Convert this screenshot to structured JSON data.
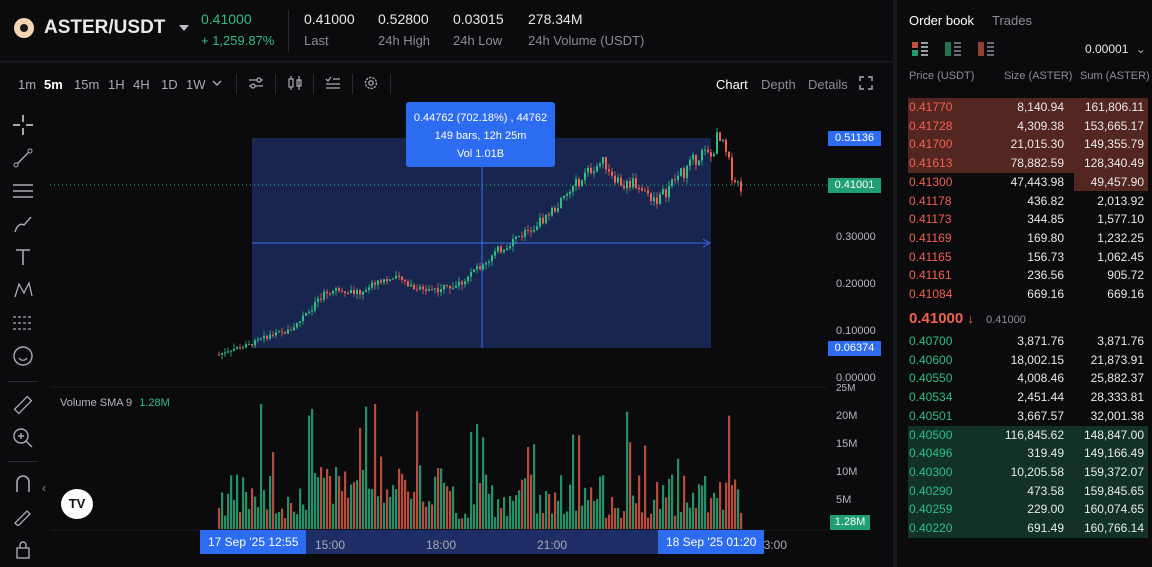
{
  "header": {
    "pair": "ASTER/USDT",
    "last_price": "0.41000",
    "change_pct": "+ 1,259.87%",
    "stats": [
      {
        "value": "0.41000",
        "label": "Last"
      },
      {
        "value": "0.52800",
        "label": "24h High"
      },
      {
        "value": "0.03015",
        "label": "24h Low"
      },
      {
        "value": "278.34M",
        "label": "24h Volume (USDT)"
      }
    ]
  },
  "toolbar": {
    "timeframes": [
      "1m",
      "5m",
      "15m",
      "1H",
      "4H",
      "1D",
      "1W"
    ],
    "active_timeframe": "5m",
    "chart_tabs": [
      "Chart",
      "Depth",
      "Details"
    ],
    "active_chart_tab": "Chart"
  },
  "chart": {
    "price_labels": [
      "0.30000",
      "0.20000",
      "0.10000",
      "0.00000"
    ],
    "top_tag": "0.51136",
    "current_tag": "0.41001",
    "bottom_tag": "0.06374",
    "volume_labels": [
      "25M",
      "20M",
      "15M",
      "10M",
      "5M"
    ],
    "volume_tag": "1.28M",
    "volume_indicator_label": "Volume SMA 9",
    "volume_indicator_value": "1.28M",
    "tooltip": {
      "line1": "0.44762 (702.18%) , 44762",
      "line2": "149 bars, 12h 25m",
      "line3": "Vol 1.01B"
    },
    "time_labels": [
      "15:00",
      "18:00",
      "21:00",
      "03:00"
    ],
    "start_time_tag": "17 Sep '25    12:55",
    "end_time_tag": "18 Sep '25    01:20",
    "colors": {
      "up": "#2ebd85",
      "down": "#f0614f",
      "accent": "#2d6bf0"
    }
  },
  "orderbook": {
    "tabs": [
      "Order book",
      "Trades"
    ],
    "active_tab": "Order book",
    "precision": "0.00001",
    "headers": [
      "Price (USDT)",
      "Size (ASTER)",
      "Sum (ASTER)"
    ],
    "asks": [
      {
        "price": "0.41770",
        "size": "8,140.94",
        "sum": "161,806.11",
        "depth": 1.0
      },
      {
        "price": "0.41728",
        "size": "4,309.38",
        "sum": "153,665.17",
        "depth": 1.0
      },
      {
        "price": "0.41700",
        "size": "21,015.30",
        "sum": "149,355.79",
        "depth": 1.0
      },
      {
        "price": "0.41613",
        "size": "78,882.59",
        "sum": "128,340.49",
        "depth": 1.0
      },
      {
        "price": "0.41300",
        "size": "47,443.98",
        "sum": "49,457.90",
        "depth": 0.31
      },
      {
        "price": "0.41178",
        "size": "436.82",
        "sum": "2,013.92",
        "depth": 0
      },
      {
        "price": "0.41173",
        "size": "344.85",
        "sum": "1,577.10",
        "depth": 0
      },
      {
        "price": "0.41169",
        "size": "169.80",
        "sum": "1,232.25",
        "depth": 0
      },
      {
        "price": "0.41165",
        "size": "156.73",
        "sum": "1,062.45",
        "depth": 0
      },
      {
        "price": "0.41161",
        "size": "236.56",
        "sum": "905.72",
        "depth": 0
      },
      {
        "price": "0.41084",
        "size": "669.16",
        "sum": "669.16",
        "depth": 0
      }
    ],
    "mid_price": "0.41000",
    "mid_sub": "0.41000",
    "bids": [
      {
        "price": "0.40700",
        "size": "3,871.76",
        "sum": "3,871.76",
        "depth": 0
      },
      {
        "price": "0.40600",
        "size": "18,002.15",
        "sum": "21,873.91",
        "depth": 0
      },
      {
        "price": "0.40550",
        "size": "4,008.46",
        "sum": "25,882.37",
        "depth": 0
      },
      {
        "price": "0.40534",
        "size": "2,451.44",
        "sum": "28,333.81",
        "depth": 0
      },
      {
        "price": "0.40501",
        "size": "3,667.57",
        "sum": "32,001.38",
        "depth": 0
      },
      {
        "price": "0.40500",
        "size": "116,845.62",
        "sum": "148,847.00",
        "depth": 1.0
      },
      {
        "price": "0.40496",
        "size": "319.49",
        "sum": "149,166.49",
        "depth": 1.0
      },
      {
        "price": "0.40300",
        "size": "10,205.58",
        "sum": "159,372.07",
        "depth": 1.0
      },
      {
        "price": "0.40290",
        "size": "473.58",
        "sum": "159,845.65",
        "depth": 1.0
      },
      {
        "price": "0.40259",
        "size": "229.00",
        "sum": "160,074.65",
        "depth": 1.0
      },
      {
        "price": "0.40220",
        "size": "691.49",
        "sum": "160,766.14",
        "depth": 1.0
      }
    ]
  }
}
